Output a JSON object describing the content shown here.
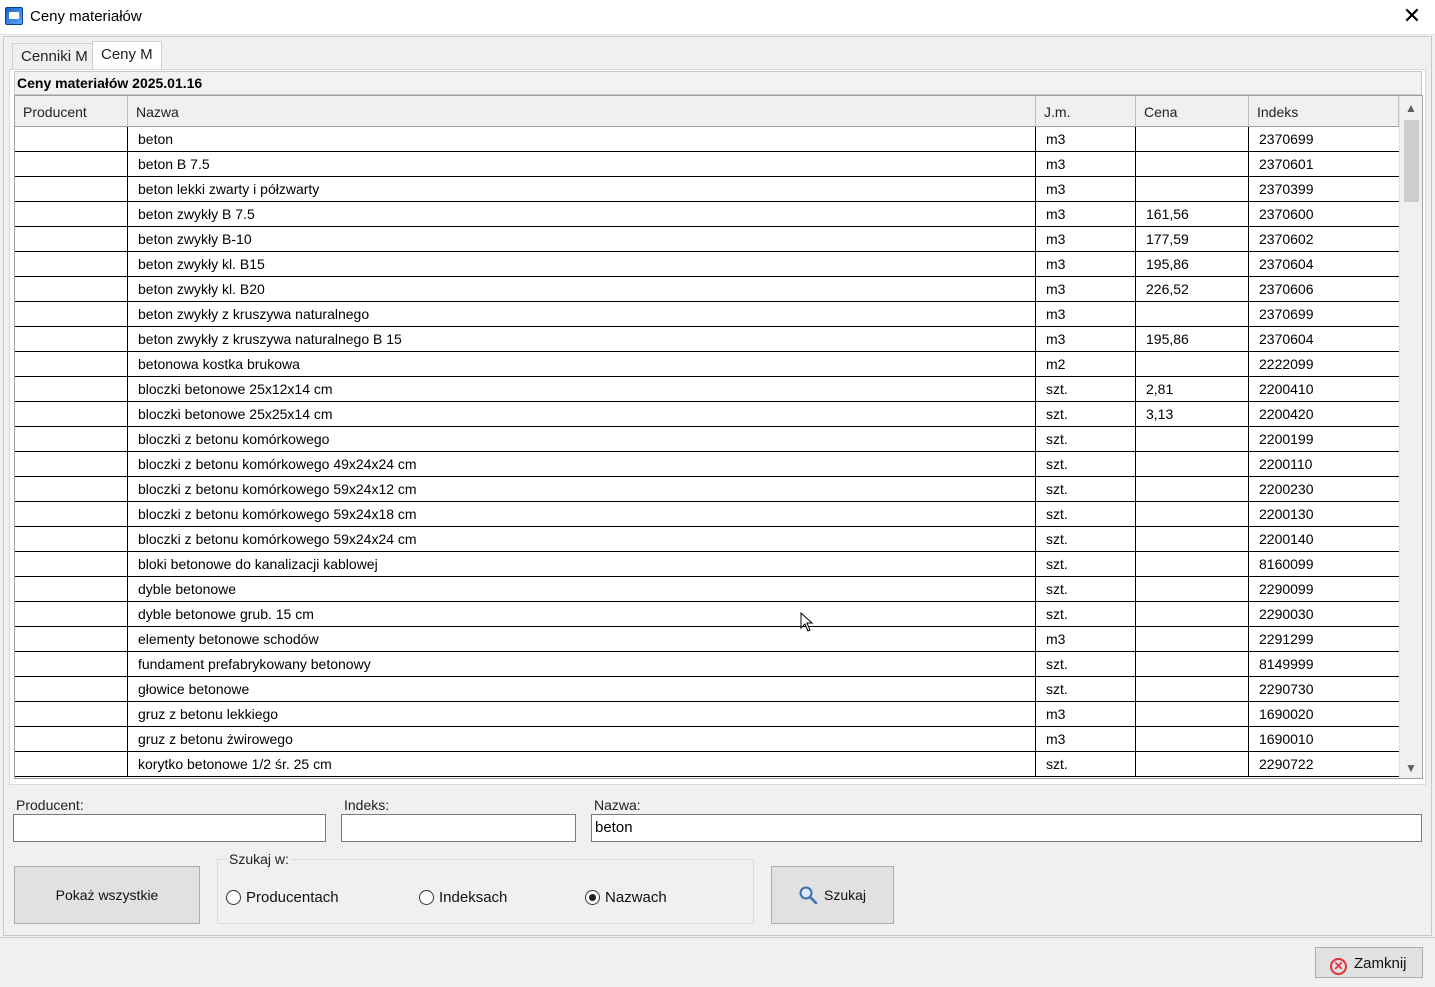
{
  "window": {
    "title": "Ceny materiałów",
    "close_glyph": "✕"
  },
  "tabs": [
    {
      "label": "Cenniki M",
      "active": false
    },
    {
      "label": "Ceny M",
      "active": true
    }
  ],
  "grid": {
    "title": "Ceny materiałów 2025.01.16",
    "columns": [
      "Producent",
      "Nazwa",
      "J.m.",
      "Cena",
      "Indeks"
    ],
    "rows": [
      [
        "",
        "beton",
        "m3",
        "",
        "2370699"
      ],
      [
        "",
        "beton B 7.5",
        "m3",
        "",
        "2370601"
      ],
      [
        "",
        "beton lekki zwarty i półzwarty",
        "m3",
        "",
        "2370399"
      ],
      [
        "",
        "beton zwykły B 7.5",
        "m3",
        "161,56",
        "2370600"
      ],
      [
        "",
        "beton zwykły B-10",
        "m3",
        "177,59",
        "2370602"
      ],
      [
        "",
        "beton zwykły kl. B15",
        "m3",
        "195,86",
        "2370604"
      ],
      [
        "",
        "beton zwykły kl. B20",
        "m3",
        "226,52",
        "2370606"
      ],
      [
        "",
        "beton zwykły z kruszywa naturalnego",
        "m3",
        "",
        "2370699"
      ],
      [
        "",
        "beton zwykły z kruszywa naturalnego B 15",
        "m3",
        "195,86",
        "2370604"
      ],
      [
        "",
        "betonowa kostka brukowa",
        "m2",
        "",
        "2222099"
      ],
      [
        "",
        "bloczki betonowe 25x12x14 cm",
        "szt.",
        "2,81",
        "2200410"
      ],
      [
        "",
        "bloczki betonowe 25x25x14 cm",
        "szt.",
        "3,13",
        "2200420"
      ],
      [
        "",
        "bloczki z betonu komórkowego",
        "szt.",
        "",
        "2200199"
      ],
      [
        "",
        "bloczki z betonu komórkowego 49x24x24 cm",
        "szt.",
        "",
        "2200110"
      ],
      [
        "",
        "bloczki z betonu komórkowego 59x24x12 cm",
        "szt.",
        "",
        "2200230"
      ],
      [
        "",
        "bloczki z betonu komórkowego 59x24x18 cm",
        "szt.",
        "",
        "2200130"
      ],
      [
        "",
        "bloczki z betonu komórkowego 59x24x24 cm",
        "szt.",
        "",
        "2200140"
      ],
      [
        "",
        "bloki betonowe do kanalizacji kablowej",
        "szt.",
        "",
        "8160099"
      ],
      [
        "",
        "dyble betonowe",
        "szt.",
        "",
        "2290099"
      ],
      [
        "",
        "dyble betonowe grub. 15 cm",
        "szt.",
        "",
        "2290030"
      ],
      [
        "",
        "elementy betonowe schodów",
        "m3",
        "",
        "2291299"
      ],
      [
        "",
        "fundament prefabrykowany betonowy",
        "szt.",
        "",
        "8149999"
      ],
      [
        "",
        "głowice betonowe",
        "szt.",
        "",
        "2290730"
      ],
      [
        "",
        "gruz z betonu lekkiego",
        "m3",
        "",
        "1690020"
      ],
      [
        "",
        "gruz z betonu żwirowego",
        "m3",
        "",
        "1690010"
      ],
      [
        "",
        "korytko betonowe 1/2 śr. 25 cm",
        "szt.",
        "",
        "2290722"
      ]
    ]
  },
  "search": {
    "producent_label": "Producent:",
    "indeks_label": "Indeks:",
    "nazwa_label": "Nazwa:",
    "producent_value": "",
    "indeks_value": "",
    "nazwa_value": "beton",
    "show_all_label": "Pokaż wszystkie",
    "group_label": "Szukaj w:",
    "radio_producent": "Producentach",
    "radio_indeks": "Indeksach",
    "radio_nazwa": "Nazwach",
    "selected": "Nazwach",
    "search_button": "Szukaj"
  },
  "footer": {
    "close_button": "Zamknij"
  },
  "colors": {
    "close_icon": "#e0303a",
    "search_icon": "#3a6fb0"
  }
}
